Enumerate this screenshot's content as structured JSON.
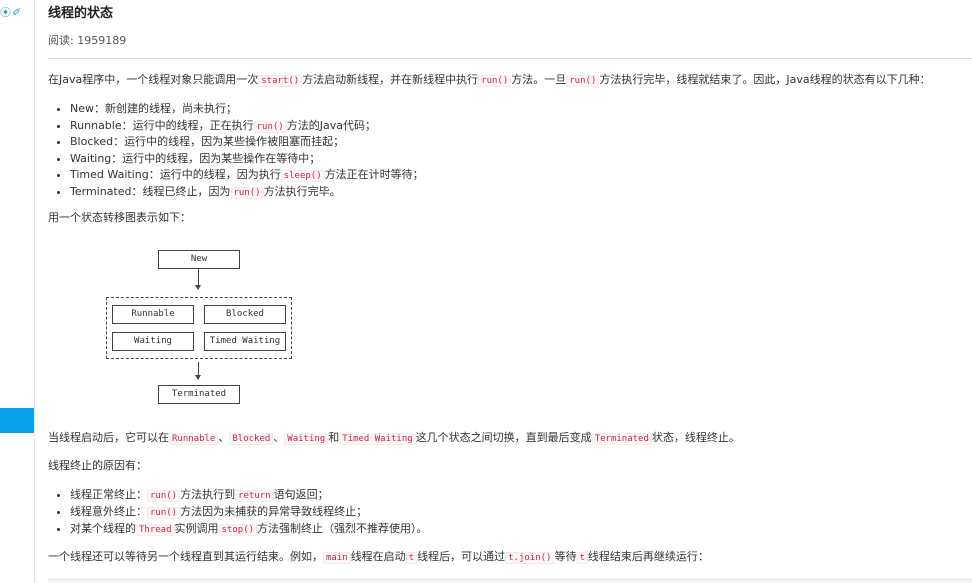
{
  "sidebar": {
    "icons": [
      "target-icon",
      "pin-icon"
    ]
  },
  "article": {
    "title": "线程的状态",
    "reads_label": "阅读: 1959189",
    "intro": [
      "在Java程序中，一个线程对象只能调用一次",
      "start()",
      "方法启动新线程，并在新线程中执行",
      "run()",
      "方法。一旦",
      "run()",
      "方法执行完毕，线程就结束了。因此，Java线程的状态有以下几种："
    ],
    "states": [
      [
        "New：新创建的线程，尚未执行；"
      ],
      [
        "Runnable：运行中的线程，正在执行",
        "run()",
        "方法的Java代码；"
      ],
      [
        "Blocked：运行中的线程，因为某些操作被阻塞而挂起；"
      ],
      [
        "Waiting：运行中的线程，因为某些操作在等待中；"
      ],
      [
        "Timed Waiting：运行中的线程，因为执行",
        "sleep()",
        "方法正在计时等待；"
      ],
      [
        "Terminated：线程已终止，因为",
        "run()",
        "方法执行完毕。"
      ]
    ],
    "diagram_intro": "用一个状态转移图表示如下：",
    "diagram": {
      "new": "New",
      "runnable": "Runnable",
      "blocked": "Blocked",
      "waiting": "Waiting",
      "timed_waiting": "Timed Waiting",
      "terminated": "Terminated"
    },
    "switch_text": [
      "当线程启动后，它可以在",
      "Runnable",
      "、",
      "Blocked",
      "、",
      "Waiting",
      "和",
      "Timed Waiting",
      "这几个状态之间切换，直到最后变成",
      "Terminated",
      "状态，线程终止。"
    ],
    "reasons_title": "线程终止的原因有：",
    "reasons": [
      [
        "线程正常终止：",
        "run()",
        "方法执行到",
        "return",
        "语句返回；"
      ],
      [
        "线程意外终止：",
        "run()",
        "方法因为未捕获的异常导致线程终止；"
      ],
      [
        "对某个线程的",
        "Thread",
        "实例调用",
        "stop()",
        "方法强制终止（强烈不推荐使用）。"
      ]
    ],
    "join_text": [
      "一个线程还可以等待另一个线程直到其运行结束。例如，",
      "main",
      "线程在启动",
      "t",
      "线程后，可以通过",
      "t.join()",
      "等待",
      "t",
      "线程结束后再继续运行："
    ]
  }
}
